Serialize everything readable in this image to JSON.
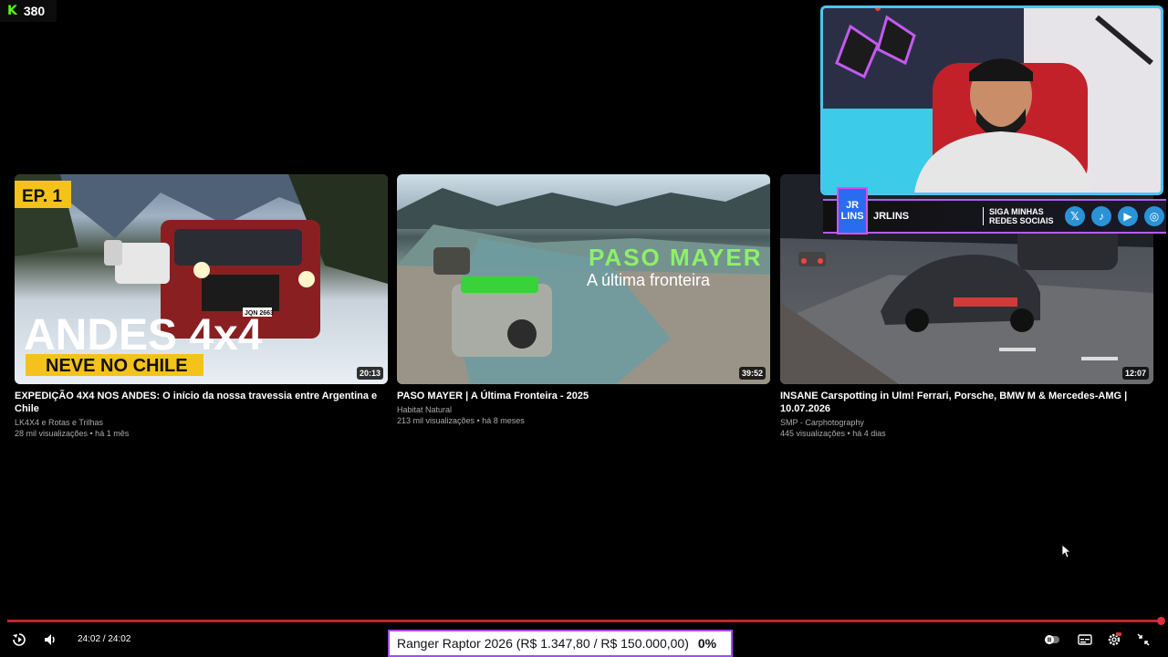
{
  "kick": {
    "logo": "K",
    "viewers": "380"
  },
  "videos": [
    {
      "title": "EXPEDIÇÃO 4X4 NOS ANDES: O início da nossa travessia entre Argentina e Chile",
      "channel": "LK4X4 e Rotas e Trilhas",
      "stats": "28 mil visualizações • há 1 mês",
      "duration": "20:13",
      "thumb_badge": "EP. 1",
      "thumb_headline": "ANDES 4x4",
      "thumb_sub": "NEVE NO CHILE",
      "thumb_plate": "JQN 2663"
    },
    {
      "title": "PASO MAYER | A Última Fronteira - 2025",
      "channel": "Habitat Natural",
      "stats": "213 mil visualizações • há 8 meses",
      "duration": "39:52",
      "thumb_headline": "PASO MAYER",
      "thumb_sub": "A última fronteira"
    },
    {
      "title": "INSANE Carspotting in Ulm! Ferrari, Porsche, BMW M & Mercedes-AMG | 10.07.2026",
      "channel": "SMP - Carphotography",
      "stats": "445 visualizações • há 4 dias",
      "duration": "12:07"
    }
  ],
  "social_banner": {
    "logo_top": "JR",
    "logo_bottom": "LINS",
    "name": "JRLINS",
    "cta_line1": "SIGA MINHAS",
    "cta_line2": "REDES SOCIAIS",
    "icons": [
      "x-icon",
      "tiktok-icon",
      "youtube-icon",
      "instagram-icon"
    ],
    "icon_glyphs": [
      "𝕏",
      "♪",
      "▶",
      "◎"
    ]
  },
  "player": {
    "time": "24:02 / 24:02",
    "progress": 1.0,
    "accent": "#c4252f"
  },
  "goal": {
    "text": "Ranger Raptor 2026 (R$ 1.347,80 / R$ 150.000,00)",
    "percent": "0%"
  },
  "colors": {
    "kick_green": "#53fc18",
    "cam_border": "#4ec3f2",
    "banner_accent": "#b45cf0",
    "goal_border": "#a44cf0"
  }
}
